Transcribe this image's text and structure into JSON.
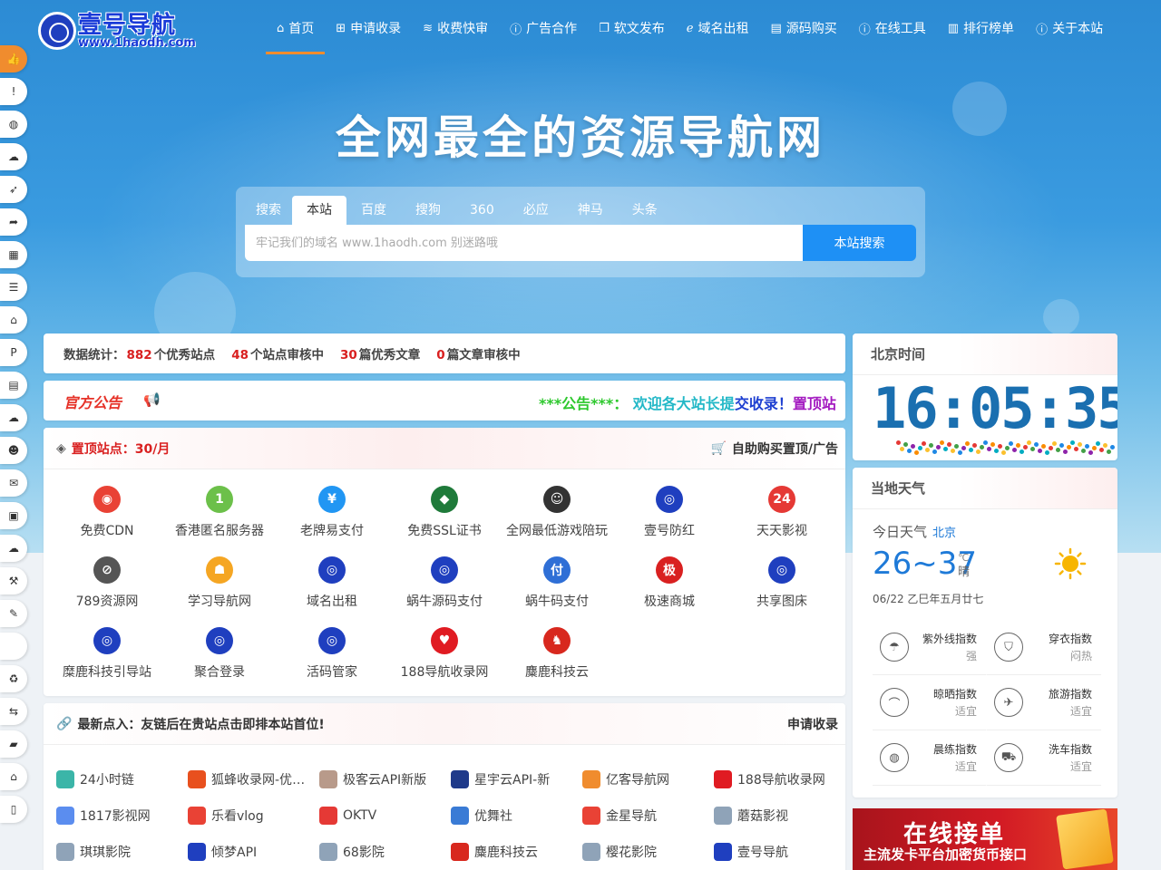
{
  "header": {
    "logo_name": "壹号导航",
    "logo_url": "www.1haodh.com",
    "nav": [
      {
        "icon": "⌂",
        "label": "首页",
        "active": true
      },
      {
        "icon": "⊞",
        "label": "申请收录"
      },
      {
        "icon": "≋",
        "label": "收费快审"
      },
      {
        "icon": "ⓘ",
        "label": "广告合作"
      },
      {
        "icon": "❐",
        "label": "软文发布"
      },
      {
        "icon": "ℯ",
        "label": "域名出租"
      },
      {
        "icon": "▤",
        "label": "源码购买"
      },
      {
        "icon": "ⓘ",
        "label": "在线工具"
      },
      {
        "icon": "▥",
        "label": "排行榜单"
      },
      {
        "icon": "ⓘ",
        "label": "关于本站"
      }
    ]
  },
  "side_tools": [
    {
      "icon": "👍",
      "name": "thumbs-up-icon",
      "hot": true
    },
    {
      "icon": "!",
      "name": "alert-icon"
    },
    {
      "icon": "◍",
      "name": "globe-icon"
    },
    {
      "icon": "☁",
      "name": "cloud-icon"
    },
    {
      "icon": "➶",
      "name": "rocket-icon"
    },
    {
      "icon": "➦",
      "name": "share-icon"
    },
    {
      "icon": "▦",
      "name": "film-icon"
    },
    {
      "icon": "☰",
      "name": "database-icon"
    },
    {
      "icon": "⌂",
      "name": "bank-icon"
    },
    {
      "icon": "P",
      "name": "paypal-icon"
    },
    {
      "icon": "▤",
      "name": "book-icon"
    },
    {
      "icon": "☁",
      "name": "cloud-download-icon"
    },
    {
      "icon": "☻",
      "name": "users-icon"
    },
    {
      "icon": "✉",
      "name": "comments-icon"
    },
    {
      "icon": "▣",
      "name": "archive-icon"
    },
    {
      "icon": "☁",
      "name": "cloud-alt-icon"
    },
    {
      "icon": "⚒",
      "name": "gavel-icon"
    },
    {
      "icon": "✎",
      "name": "wrench-icon"
    },
    {
      "icon": "",
      "name": "blank-icon"
    },
    {
      "icon": "♻",
      "name": "recycle-icon"
    },
    {
      "icon": "⇆",
      "name": "handshake-icon"
    },
    {
      "icon": "▰",
      "name": "shopping-bag-icon"
    },
    {
      "icon": "⌂",
      "name": "institution-icon"
    },
    {
      "icon": "▯",
      "name": "file-icon"
    }
  ],
  "hero": {
    "title": "全网最全的资源导航网",
    "search_tabs": [
      "搜索",
      "本站",
      "百度",
      "搜狗",
      "360",
      "必应",
      "神马",
      "头条"
    ],
    "search_active": 1,
    "placeholder": "牢记我们的域名 www.1haodh.com 别迷路哦",
    "search_button": "本站搜索"
  },
  "stats": {
    "label": "数据统计：",
    "sites": "882",
    "sites_label": "个优秀站点",
    "pending": "48",
    "pending_label": "个站点审核中",
    "articles": "30",
    "articles_label": "篇优秀文章",
    "pending_articles": "0",
    "pending_articles_label": "篇文章审核中"
  },
  "notice": {
    "label": "官方公告",
    "part1": "***公告***：",
    "part2": "欢迎各大站长提",
    "part3": "交收录！",
    "part4": "置顶站"
  },
  "top_sites": {
    "title": "置顶站点：30/月",
    "action": "自助购买置顶/广告",
    "items": [
      {
        "name": "免费CDN",
        "icon": "chrome-icon",
        "color": "#e94235",
        "glyph": "◉"
      },
      {
        "name": "香港匿名服务器",
        "icon": "cloud-server-icon",
        "color": "#6cc04a",
        "glyph": "1"
      },
      {
        "name": "老牌易支付",
        "icon": "wallet-icon",
        "color": "#2196f3",
        "glyph": "¥"
      },
      {
        "name": "免费SSL证书",
        "icon": "ssl-icon",
        "color": "#1f7a3a",
        "glyph": "◆"
      },
      {
        "name": "全网最低游戏陪玩",
        "icon": "avatar-icon",
        "color": "#333333",
        "glyph": "☺"
      },
      {
        "name": "壹号防红",
        "icon": "1haodh-logo-icon",
        "color": "#1f3fbf",
        "glyph": "◎"
      },
      {
        "name": "天天影视",
        "icon": "tv-icon",
        "color": "#e53935",
        "glyph": "24"
      },
      {
        "name": "789资源网",
        "icon": "compass-icon",
        "color": "#555555",
        "glyph": "⊘"
      },
      {
        "name": "学习导航网",
        "icon": "family-icon",
        "color": "#f5a623",
        "glyph": "☗"
      },
      {
        "name": "域名出租",
        "icon": "1haodh-logo-icon",
        "color": "#1f3fbf",
        "glyph": "◎"
      },
      {
        "name": "蜗牛源码支付",
        "icon": "1haodh-logo-icon",
        "color": "#1f3fbf",
        "glyph": "◎"
      },
      {
        "name": "蜗牛码支付",
        "icon": "pay-icon",
        "color": "#2f6fd6",
        "glyph": "付"
      },
      {
        "name": "极速商城",
        "icon": "mall-icon",
        "color": "#d92020",
        "glyph": "极"
      },
      {
        "name": "共享图床",
        "icon": "1haodh-logo-icon",
        "color": "#1f3fbf",
        "glyph": "◎"
      },
      {
        "name": "糜鹿科技引导站",
        "icon": "1haodh-logo-icon",
        "color": "#1f3fbf",
        "glyph": "◎"
      },
      {
        "name": "聚合登录",
        "icon": "1haodh-logo-icon",
        "color": "#1f3fbf",
        "glyph": "◎"
      },
      {
        "name": "活码管家",
        "icon": "1haodh-logo-icon",
        "color": "#1f3fbf",
        "glyph": "◎"
      },
      {
        "name": "188导航收录网",
        "icon": "heart-icon",
        "color": "#e01b22",
        "glyph": "♥"
      },
      {
        "name": "麋鹿科技云",
        "icon": "deer-icon",
        "color": "#d8281e",
        "glyph": "♞"
      }
    ]
  },
  "latest": {
    "title": "最新点入：友链后在贵站点击即排本站首位!",
    "action": "申请收录",
    "items": [
      {
        "name": "24小时链",
        "icon": "link-logo-icon",
        "color": "#3bb5a8"
      },
      {
        "name": "狐蜂收录网-优质网站",
        "icon": "fox-icon",
        "color": "#e8501e"
      },
      {
        "name": "极客云API新版",
        "icon": "anime-icon",
        "color": "#b89a8a"
      },
      {
        "name": "星宇云API-新",
        "icon": "cube-icon",
        "color": "#1f3a8a"
      },
      {
        "name": "亿客导航网",
        "icon": "yk-icon",
        "color": "#f08c2e"
      },
      {
        "name": "188导航收录网",
        "icon": "heart-icon",
        "color": "#e01b22"
      },
      {
        "name": "1817影视网",
        "icon": "play-icon",
        "color": "#5b8def"
      },
      {
        "name": "乐看vlog",
        "icon": "chrome-icon",
        "color": "#e94235"
      },
      {
        "name": "OKTV",
        "icon": "play-red-icon",
        "color": "#e53935"
      },
      {
        "name": "优舞社",
        "icon": "dance-icon",
        "color": "#3a7bd5"
      },
      {
        "name": "金星导航",
        "icon": "chrome-icon",
        "color": "#e94235"
      },
      {
        "name": "蘑菇影视",
        "icon": "image-icon",
        "color": "#8fa3b8"
      },
      {
        "name": "琪琪影院",
        "icon": "image-icon",
        "color": "#8fa3b8"
      },
      {
        "name": "倾梦API",
        "icon": "1haodh-logo-icon",
        "color": "#1f3fbf"
      },
      {
        "name": "68影院",
        "icon": "image-icon",
        "color": "#8fa3b8"
      },
      {
        "name": "麋鹿科技云",
        "icon": "deer-icon",
        "color": "#d8281e"
      },
      {
        "name": "樱花影院",
        "icon": "image-icon",
        "color": "#8fa3b8"
      },
      {
        "name": "壹号导航",
        "icon": "1haodh-logo-icon",
        "color": "#1f3fbf"
      }
    ]
  },
  "clock": {
    "title": "北京时间",
    "time": "16:05:35"
  },
  "weather": {
    "title": "当地天气",
    "label": "今日天气",
    "city": "北京",
    "temp": "26~37",
    "unit": "℃",
    "condition": "晴",
    "date": "06/22 乙巳年五月廿七",
    "indices": [
      {
        "name": "紫外线指数",
        "value": "强",
        "icon": "umbrella-icon",
        "glyph": "☂"
      },
      {
        "name": "穿衣指数",
        "value": "闷热",
        "icon": "shirt-icon",
        "glyph": "⛉"
      },
      {
        "name": "晾晒指数",
        "value": "适宜",
        "icon": "hanger-icon",
        "glyph": "⌒"
      },
      {
        "name": "旅游指数",
        "value": "适宜",
        "icon": "plane-icon",
        "glyph": "✈"
      },
      {
        "name": "晨练指数",
        "value": "适宜",
        "icon": "basketball-icon",
        "glyph": "◍"
      },
      {
        "name": "洗车指数",
        "value": "适宜",
        "icon": "car-icon",
        "glyph": "⛟"
      }
    ]
  },
  "ad": {
    "title": "在线接单",
    "subtitle": "主流发卡平台加密货币接口"
  },
  "colors": {
    "accent": "#f08c2e",
    "brand": "#1f3fbf",
    "alert": "#d92020",
    "search_button": "#1e90f5"
  }
}
